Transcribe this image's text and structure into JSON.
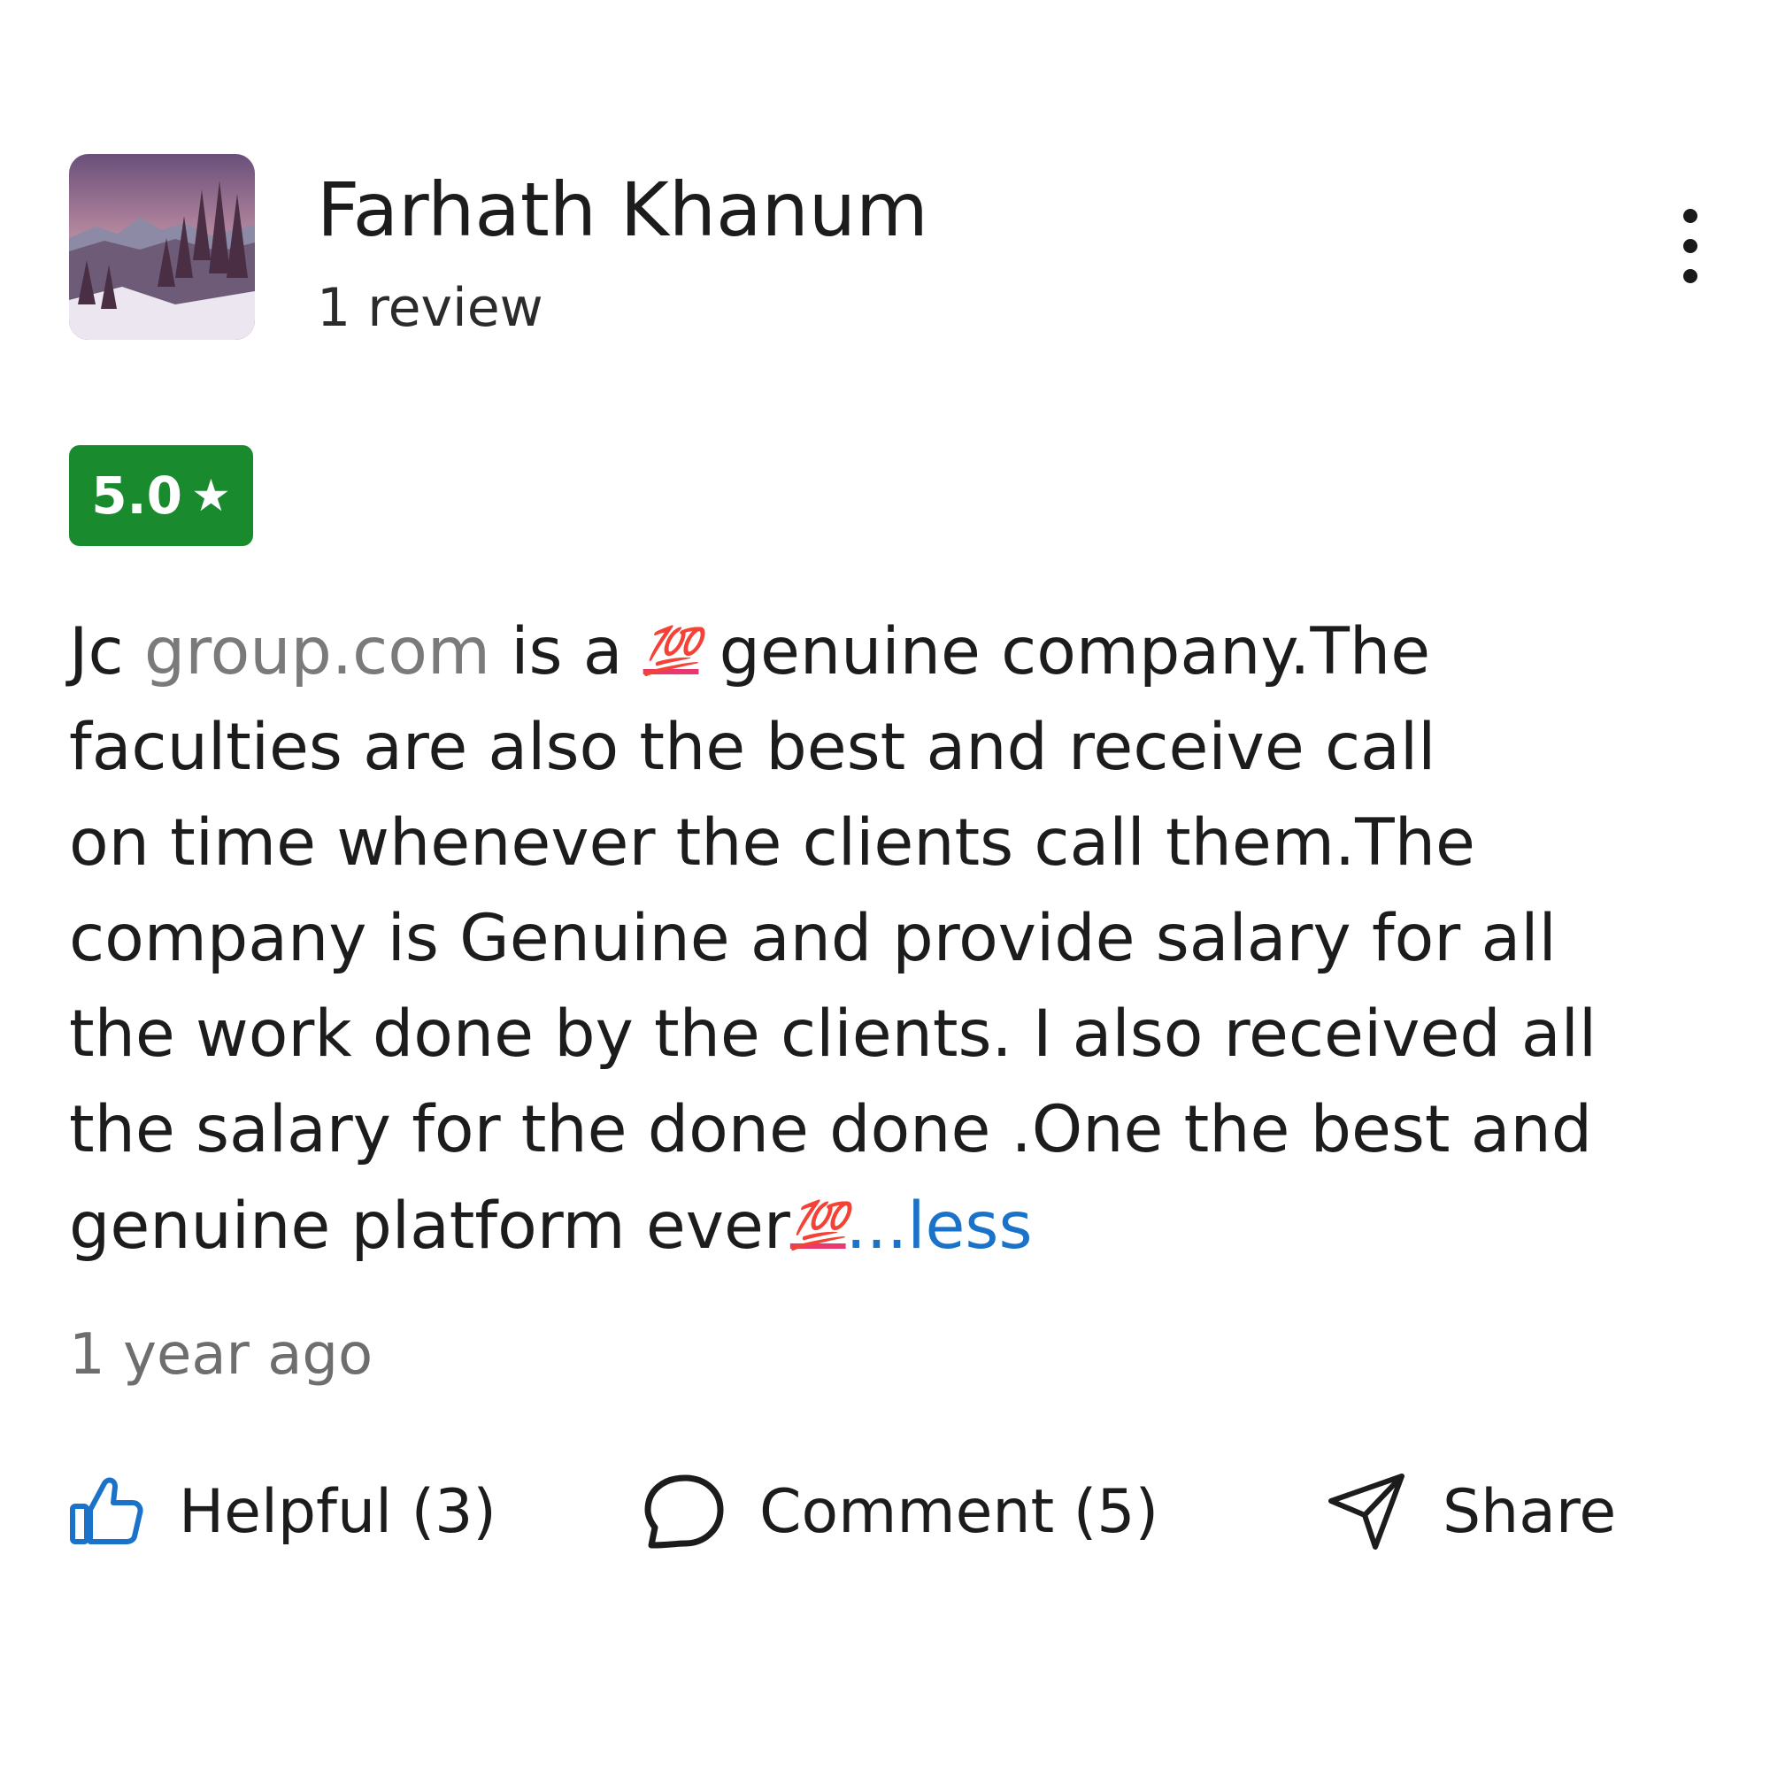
{
  "reviewer": {
    "name": "Farhath Khanum",
    "review_count": "1 review"
  },
  "rating": {
    "value": "5.0",
    "star": "★",
    "color": "#1a8a2e"
  },
  "review": {
    "line1_prefix": "Jc ",
    "line1_link": "group.com",
    "line1_mid": " is a ",
    "emoji_1": "💯",
    "line1_suffix": " genuine company.The",
    "line2": "faculties are also the best and receive call",
    "line3": "on time whenever the clients call them.The",
    "line4": "company is Genuine and provide salary for all",
    "line5": "the work done by the clients. I also received all",
    "line6": "the salary for the done done .One the best and",
    "line7_prefix": "genuine platform ever",
    "emoji_2": "💯",
    "less_link": "...less",
    "link_color": "#1a73c8"
  },
  "timestamp": "1 year ago",
  "actions": {
    "helpful": {
      "label": "Helpful (3)",
      "icon": "thumbs-up-icon",
      "icon_color": "#1a73c8"
    },
    "comment": {
      "label": "Comment (5)",
      "icon": "speech-bubble-icon"
    },
    "share": {
      "label": "Share",
      "icon": "paper-plane-icon"
    }
  },
  "menu": {
    "icon": "more-vertical-icon"
  }
}
